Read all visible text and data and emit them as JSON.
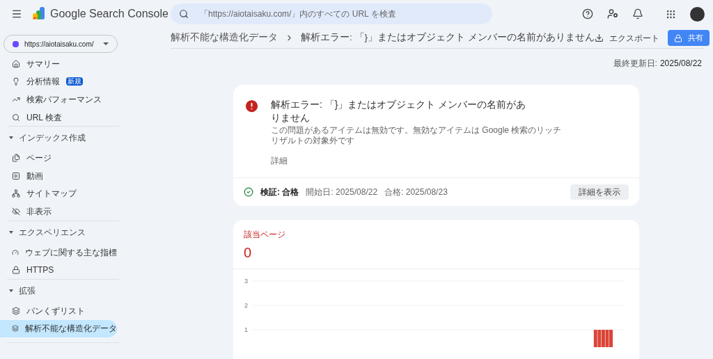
{
  "header": {
    "product": "Google Search Console",
    "search": {
      "placeholder": "「https://aiotaisaku.com/」内のすべての URL を検査"
    }
  },
  "property": {
    "url": "https://aiotaisaku.com/"
  },
  "sidebar": {
    "sections": [
      {
        "items": [
          {
            "label": "サマリー",
            "selected": false
          },
          {
            "label": "分析情報",
            "badge": "新規",
            "selected": false
          },
          {
            "label": "検索パフォーマンス",
            "selected": false
          },
          {
            "label": "URL 検査",
            "selected": false
          }
        ]
      },
      {
        "title": "インデックス作成",
        "expanded": true,
        "items": [
          {
            "label": "ページ",
            "selected": false
          },
          {
            "label": "動画",
            "selected": false
          },
          {
            "label": "サイトマップ",
            "selected": false
          },
          {
            "label": "非表示",
            "selected": false
          }
        ]
      },
      {
        "title": "エクスペリエンス",
        "expanded": true,
        "items": [
          {
            "label": "ウェブに関する主な指標",
            "selected": false
          },
          {
            "label": "HTTPS",
            "selected": false
          }
        ]
      },
      {
        "title": "拡張",
        "expanded": true,
        "items": [
          {
            "label": "パンくずリスト",
            "selected": false
          },
          {
            "label": "解析不能な構造化データ",
            "selected": true
          }
        ]
      }
    ]
  },
  "breadcrumb": [
    "解析不能な構造化データ",
    "解析エラー: 「}」またはオブジェクト メンバーの名前がありません"
  ],
  "actions": {
    "export": "エクスポート",
    "share": "共有"
  },
  "last_updated": {
    "label": "最終更新日:",
    "value": "2025/08/22"
  },
  "issue": {
    "title": "解析エラー: 「}」またはオブジェクト メンバーの名前がありません",
    "description": "この問題があるアイテムは無効です。無効なアイテムは Google 検索のリッチリザルトの対象外です",
    "details": "詳細",
    "validation": {
      "label": "検証: 合格",
      "started": "開始日: 2025/08/22",
      "passed": "合格: 2025/08/23"
    },
    "button": "詳細を表示"
  },
  "affected": {
    "label": "該当ページ",
    "value": "0",
    "chart_data": {
      "type": "bar",
      "yticks": [
        1,
        2,
        3
      ],
      "ylim": [
        0,
        3
      ],
      "values": [
        0,
        0,
        0,
        0,
        0,
        0,
        0,
        0,
        0,
        0,
        0,
        0,
        0,
        0,
        0,
        0,
        0,
        0,
        0,
        0,
        0,
        0,
        0,
        0,
        0,
        0,
        0,
        0,
        0,
        0,
        0,
        0,
        0,
        0,
        0,
        0,
        0,
        0,
        0,
        0,
        0,
        0,
        0,
        0,
        0,
        0,
        0,
        0,
        0,
        0,
        0,
        0,
        0,
        0,
        0,
        0,
        0,
        0,
        0,
        0,
        0,
        0,
        0,
        0,
        0,
        0,
        0,
        0,
        0,
        0,
        0,
        0,
        0,
        0,
        0,
        0,
        0,
        0,
        0,
        0,
        0,
        0,
        0,
        0,
        0,
        0,
        0,
        0,
        1,
        1,
        1,
        1,
        1,
        0,
        0,
        0
      ]
    }
  }
}
